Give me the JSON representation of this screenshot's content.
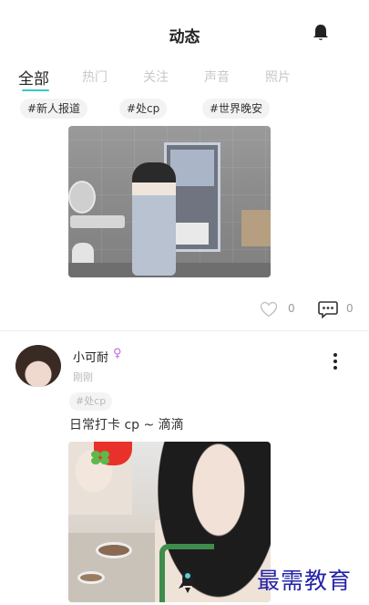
{
  "header": {
    "title": "动态",
    "bell_icon": "bell-icon"
  },
  "tabs": [
    {
      "label": "全部",
      "active": true
    },
    {
      "label": "热门",
      "active": false
    },
    {
      "label": "关注",
      "active": false
    },
    {
      "label": "声音",
      "active": false
    },
    {
      "label": "照片",
      "active": false
    }
  ],
  "accent_color": "#35c8c8",
  "topic_tags": [
    "#新人报道",
    "#处cp",
    "#世界晚安"
  ],
  "posts": [
    {
      "photo": "mirror-selfie-photo",
      "likes": "0",
      "comments": "0"
    },
    {
      "username": "小可耐",
      "gender_symbol": "♀",
      "time": "刚刚",
      "tag": "#处cp",
      "text": "日常打卡 cp ~ 滴滴",
      "photo": "dining-photo"
    }
  ],
  "watermark": "最需教育"
}
